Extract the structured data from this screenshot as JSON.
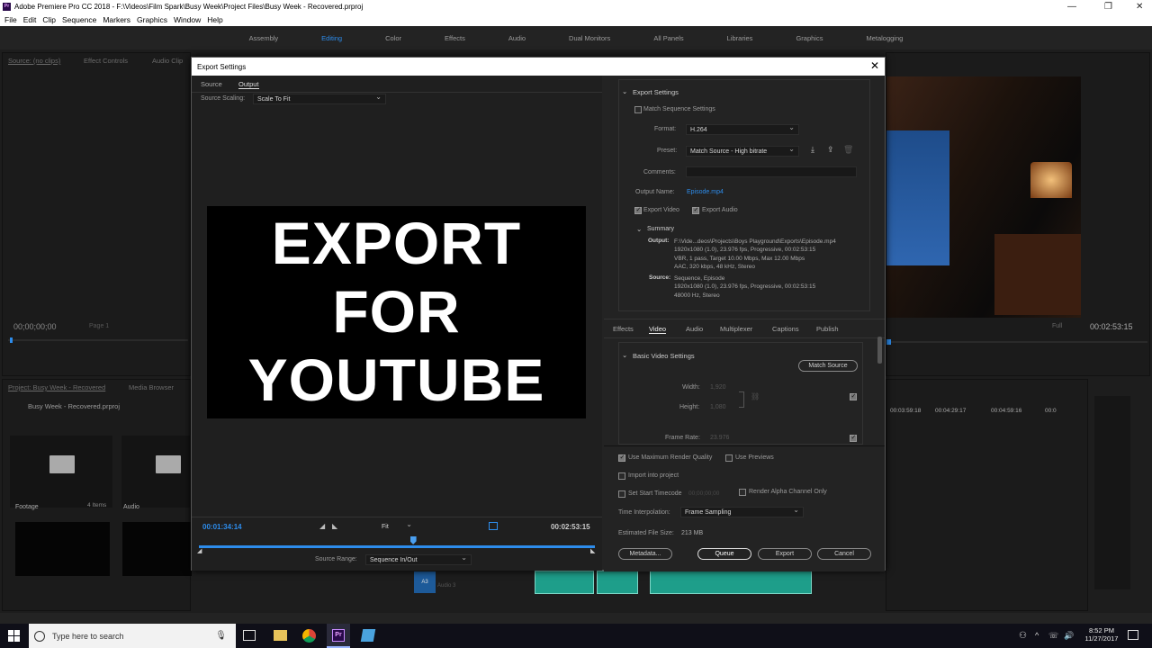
{
  "app": {
    "title": "Adobe Premiere Pro CC 2018 - F:\\Videos\\Film Spark\\Busy Week\\Project Files\\Busy Week - Recovered.prproj",
    "icon": "Pr"
  },
  "menu": [
    "File",
    "Edit",
    "Clip",
    "Sequence",
    "Markers",
    "Graphics",
    "Window",
    "Help"
  ],
  "workspaces": {
    "items": [
      "Assembly",
      "Editing",
      "Color",
      "Effects",
      "Audio",
      "Dual Monitors",
      "All Panels",
      "Libraries",
      "Graphics",
      "Metalogging"
    ],
    "active": "Editing"
  },
  "source_panel": {
    "tab1": "Source: (no clips)",
    "tab2": "Effect Controls",
    "tab3": "Audio Clip",
    "timecode": "00;00;00;00",
    "page": "Page 1"
  },
  "program_panel": {
    "full": "Full",
    "timecode": "00:02:53:15"
  },
  "project_panel": {
    "tab1": "Project: Busy Week - Recovered",
    "tab2": "Media Browser",
    "file": "Busy Week - Recovered.prproj",
    "bins": [
      {
        "name": "Footage",
        "count": "4 Items"
      },
      {
        "name": "Audio",
        "count": ""
      }
    ]
  },
  "timeline": {
    "ticks": [
      "00:03:59:18",
      "00:04:29:17",
      "00:04:59:16",
      "00:0"
    ],
    "track": "A3",
    "track_name": "Audio 3"
  },
  "dialog": {
    "title": "Export Settings",
    "tabs": [
      "Source",
      "Output"
    ],
    "active_tab": "Output",
    "source_scaling_label": "Source Scaling:",
    "source_scaling": "Scale To Fit",
    "preview_lines": [
      "EXPORT",
      "FOR",
      "YOUTUBE"
    ],
    "current_time": "00:01:34:14",
    "fit": "Fit",
    "end_time": "00:02:53:15",
    "playhead_fraction": 0.54,
    "source_range_label": "Source Range:",
    "source_range": "Sequence In/Out",
    "export_settings": {
      "header": "Export Settings",
      "match_sequence": "Match Sequence Settings",
      "format_label": "Format:",
      "format": "H.264",
      "preset_label": "Preset:",
      "preset": "Match Source - High bitrate",
      "comments_label": "Comments:",
      "output_name_label": "Output Name:",
      "output_name": "Episode.mp4",
      "export_video": "Export Video",
      "export_audio": "Export Audio",
      "summary_header": "Summary",
      "output_label": "Output:",
      "output_lines": [
        "F:\\Vide...deos\\Projects\\Boys Playground\\Exports\\Episode.mp4",
        "1920x1080 (1.0), 23.976 fps, Progressive, 00:02:53:15",
        "VBR, 1 pass, Target 10.00 Mbps, Max 12.00 Mbps",
        "AAC, 320 kbps, 48 kHz, Stereo"
      ],
      "source_label": "Source:",
      "source_lines": [
        "Sequence, Episode",
        "1920x1080 (1.0), 23.976 fps, Progressive, 00:02:53:15",
        "48000 Hz, Stereo"
      ]
    },
    "settings_tabs": [
      "Effects",
      "Video",
      "Audio",
      "Multiplexer",
      "Captions",
      "Publish"
    ],
    "settings_active": "Video",
    "video": {
      "header": "Basic Video Settings",
      "match_source": "Match Source",
      "width_label": "Width:",
      "width": "1,920",
      "height_label": "Height:",
      "height": "1,080",
      "frame_rate_label": "Frame Rate:",
      "frame_rate": "23.976"
    },
    "bottom": {
      "max_render": "Use Maximum Render Quality",
      "use_previews": "Use Previews",
      "import_project": "Import into project",
      "set_start_tc": "Set Start Timecode",
      "start_tc": "00;00;00;00",
      "render_alpha": "Render Alpha Channel Only",
      "time_interp_label": "Time Interpolation:",
      "time_interp": "Frame Sampling",
      "file_size_label": "Estimated File Size:",
      "file_size": "213 MB",
      "metadata": "Metadata...",
      "queue": "Queue",
      "export": "Export",
      "cancel": "Cancel"
    }
  },
  "taskbar": {
    "search": "Type here to search",
    "time": "8:52 PM",
    "date": "11/27/2017"
  },
  "colors": {
    "accent": "#2d8ceb",
    "audio_clip": "#1e9e8a"
  }
}
